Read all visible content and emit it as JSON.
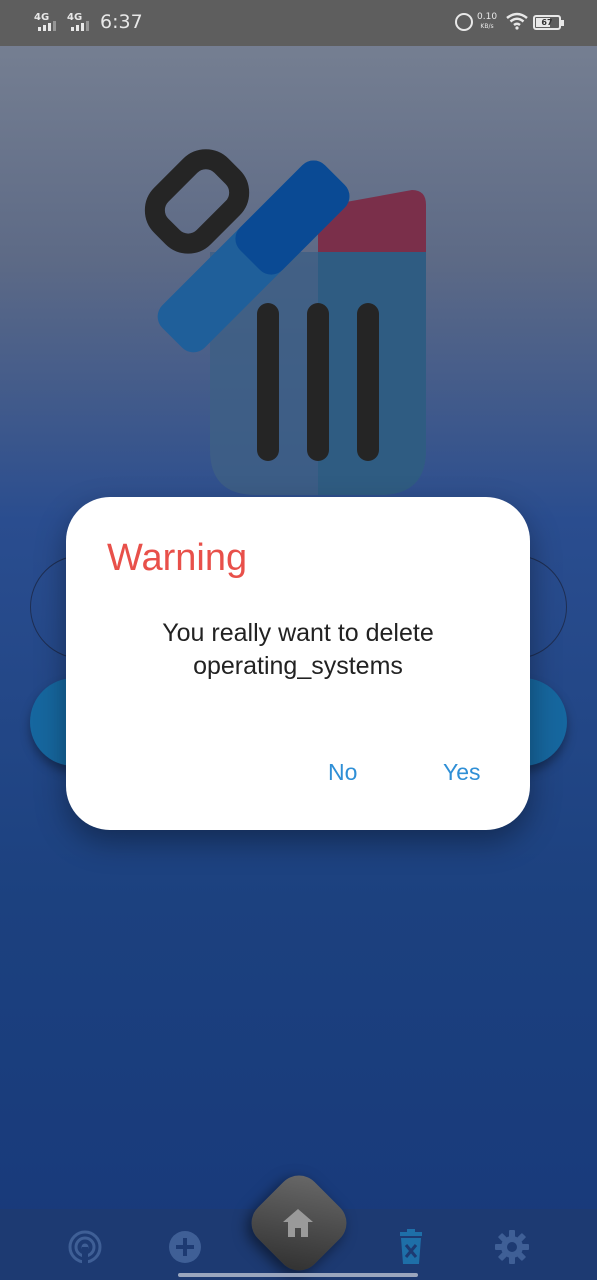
{
  "status_bar": {
    "sim1": "4G",
    "sim2": "4G",
    "time": "6:37",
    "net_speed_value": "0.10",
    "net_speed_unit": "KB/s",
    "battery_level": "67"
  },
  "illustration": {
    "icon": "trash-can-open-lid-icon"
  },
  "dialog": {
    "title": "Warning",
    "message_line1": "You really want to delete",
    "message_line2": "operating_systems",
    "no_label": "No",
    "yes_label": "Yes"
  },
  "bottom_nav": {
    "items": [
      {
        "icon": "broadcast-icon"
      },
      {
        "icon": "add-circle-icon"
      },
      {
        "icon": "home-icon"
      },
      {
        "icon": "trash-x-icon"
      },
      {
        "icon": "gear-icon"
      }
    ]
  },
  "colors": {
    "dialog_title": "#e8504a",
    "dialog_button": "#2f8fd6",
    "nav_active": "#1e6fa8",
    "nav_inactive": "#3f5f96"
  }
}
